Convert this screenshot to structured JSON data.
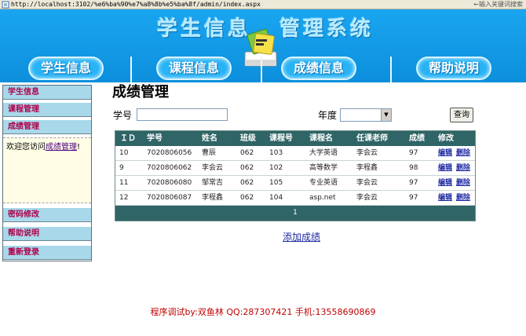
{
  "browser": {
    "url": "http://localhost:3102/%e6%ba%90%e7%a8%8b%e5%ba%8f/admin/index.aspx",
    "search_placeholder": "←输入关键词搜索"
  },
  "banner": {
    "title_part1": "学生信息",
    "title_part2": "管理系统",
    "nav": [
      "学生信息",
      "课程信息",
      "成绩信息",
      "帮助说明"
    ],
    "colors": {
      "background": "#1aa5f0",
      "button": "#27b3f6"
    }
  },
  "sidebar": {
    "items_top": [
      "学生信息",
      "课程管理",
      "成绩管理"
    ],
    "welcome_prefix": "欢迎您访问",
    "welcome_link": "成绩管理",
    "welcome_suffix": "!",
    "items_bottom": [
      "密码修改",
      "帮助说明",
      "重新登录"
    ]
  },
  "main": {
    "title": "成绩管理",
    "student_id_label": "学号",
    "student_id_value": "",
    "year_label": "年度",
    "year_value": "",
    "query_button": "查询",
    "add_link": "添加成绩"
  },
  "table": {
    "headers": [
      "ＩＤ",
      "学号",
      "姓名",
      "班级",
      "课程号",
      "课程名",
      "任课老师",
      "成绩",
      "修改"
    ],
    "rows": [
      [
        "10",
        "7020806056",
        "曹辰",
        "062",
        "103",
        "大学英语",
        "李会云",
        "97",
        "编辑",
        "删除"
      ],
      [
        "9",
        "7020806062",
        "李会云",
        "062",
        "102",
        "高等数学",
        "李程鑫",
        "98",
        "编辑",
        "删除"
      ],
      [
        "11",
        "7020806080",
        "邹常吉",
        "062",
        "105",
        "专业英语",
        "李会云",
        "97",
        "编辑",
        "删除"
      ],
      [
        "12",
        "7020806087",
        "李程鑫",
        "062",
        "104",
        "asp.net",
        "李会云",
        "97",
        "编辑",
        "删除"
      ]
    ],
    "pager": "1",
    "header_color": "#2f6566"
  },
  "footer": "程序调试by:双鱼林 QQ:287307421 手机:13558690869"
}
